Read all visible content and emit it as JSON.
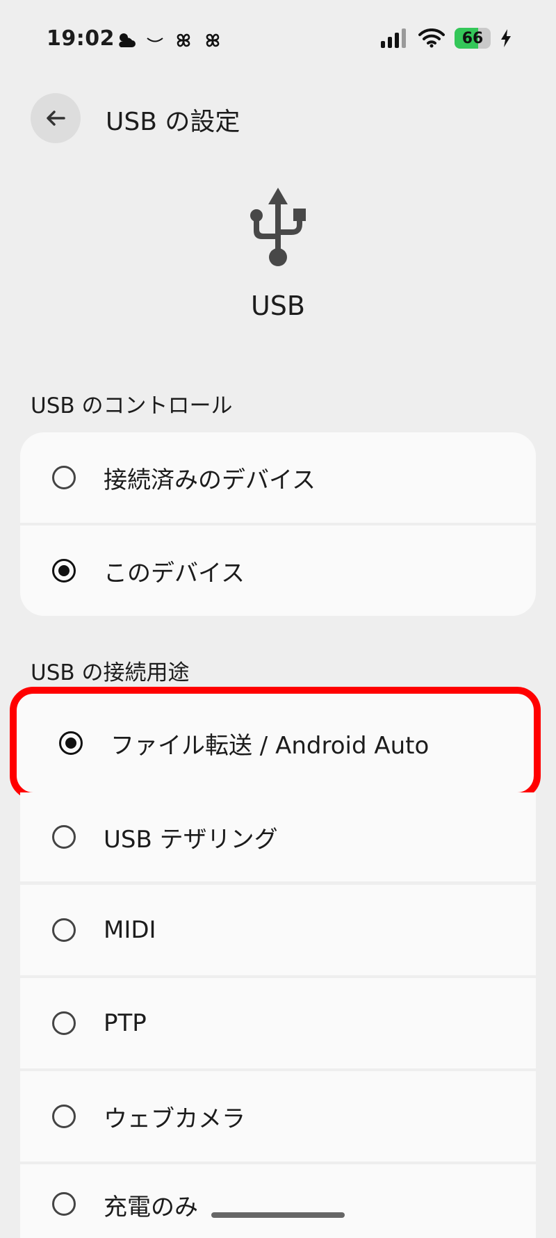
{
  "status_bar": {
    "time": "19:02",
    "notification_icons": [
      "weather-cloud-icon",
      "smile-icon",
      "pinwheel-icon",
      "pinwheel-icon"
    ],
    "battery_level": "66",
    "battery_fraction": 0.66,
    "charging": true
  },
  "header": {
    "back_icon": "arrow-left-icon",
    "title": "USB の設定"
  },
  "hero": {
    "icon": "usb-icon",
    "label": "USB"
  },
  "usb_control": {
    "title": "USB のコントロール",
    "options": [
      {
        "label": "接続済みのデバイス",
        "selected": false
      },
      {
        "label": "このデバイス",
        "selected": true
      }
    ]
  },
  "usb_use": {
    "title": "USB の接続用途",
    "options": [
      {
        "label": "ファイル転送 / Android Auto",
        "selected": true,
        "highlighted": true
      },
      {
        "label": "USB テザリング",
        "selected": false
      },
      {
        "label": "MIDI",
        "selected": false
      },
      {
        "label": "PTP",
        "selected": false
      },
      {
        "label": "ウェブカメラ",
        "selected": false
      },
      {
        "label": "充電のみ",
        "selected": false
      }
    ]
  },
  "colors": {
    "background": "#eeeeee",
    "card": "#fafafa",
    "highlight": "#ff0000",
    "battery": "#34c759"
  }
}
